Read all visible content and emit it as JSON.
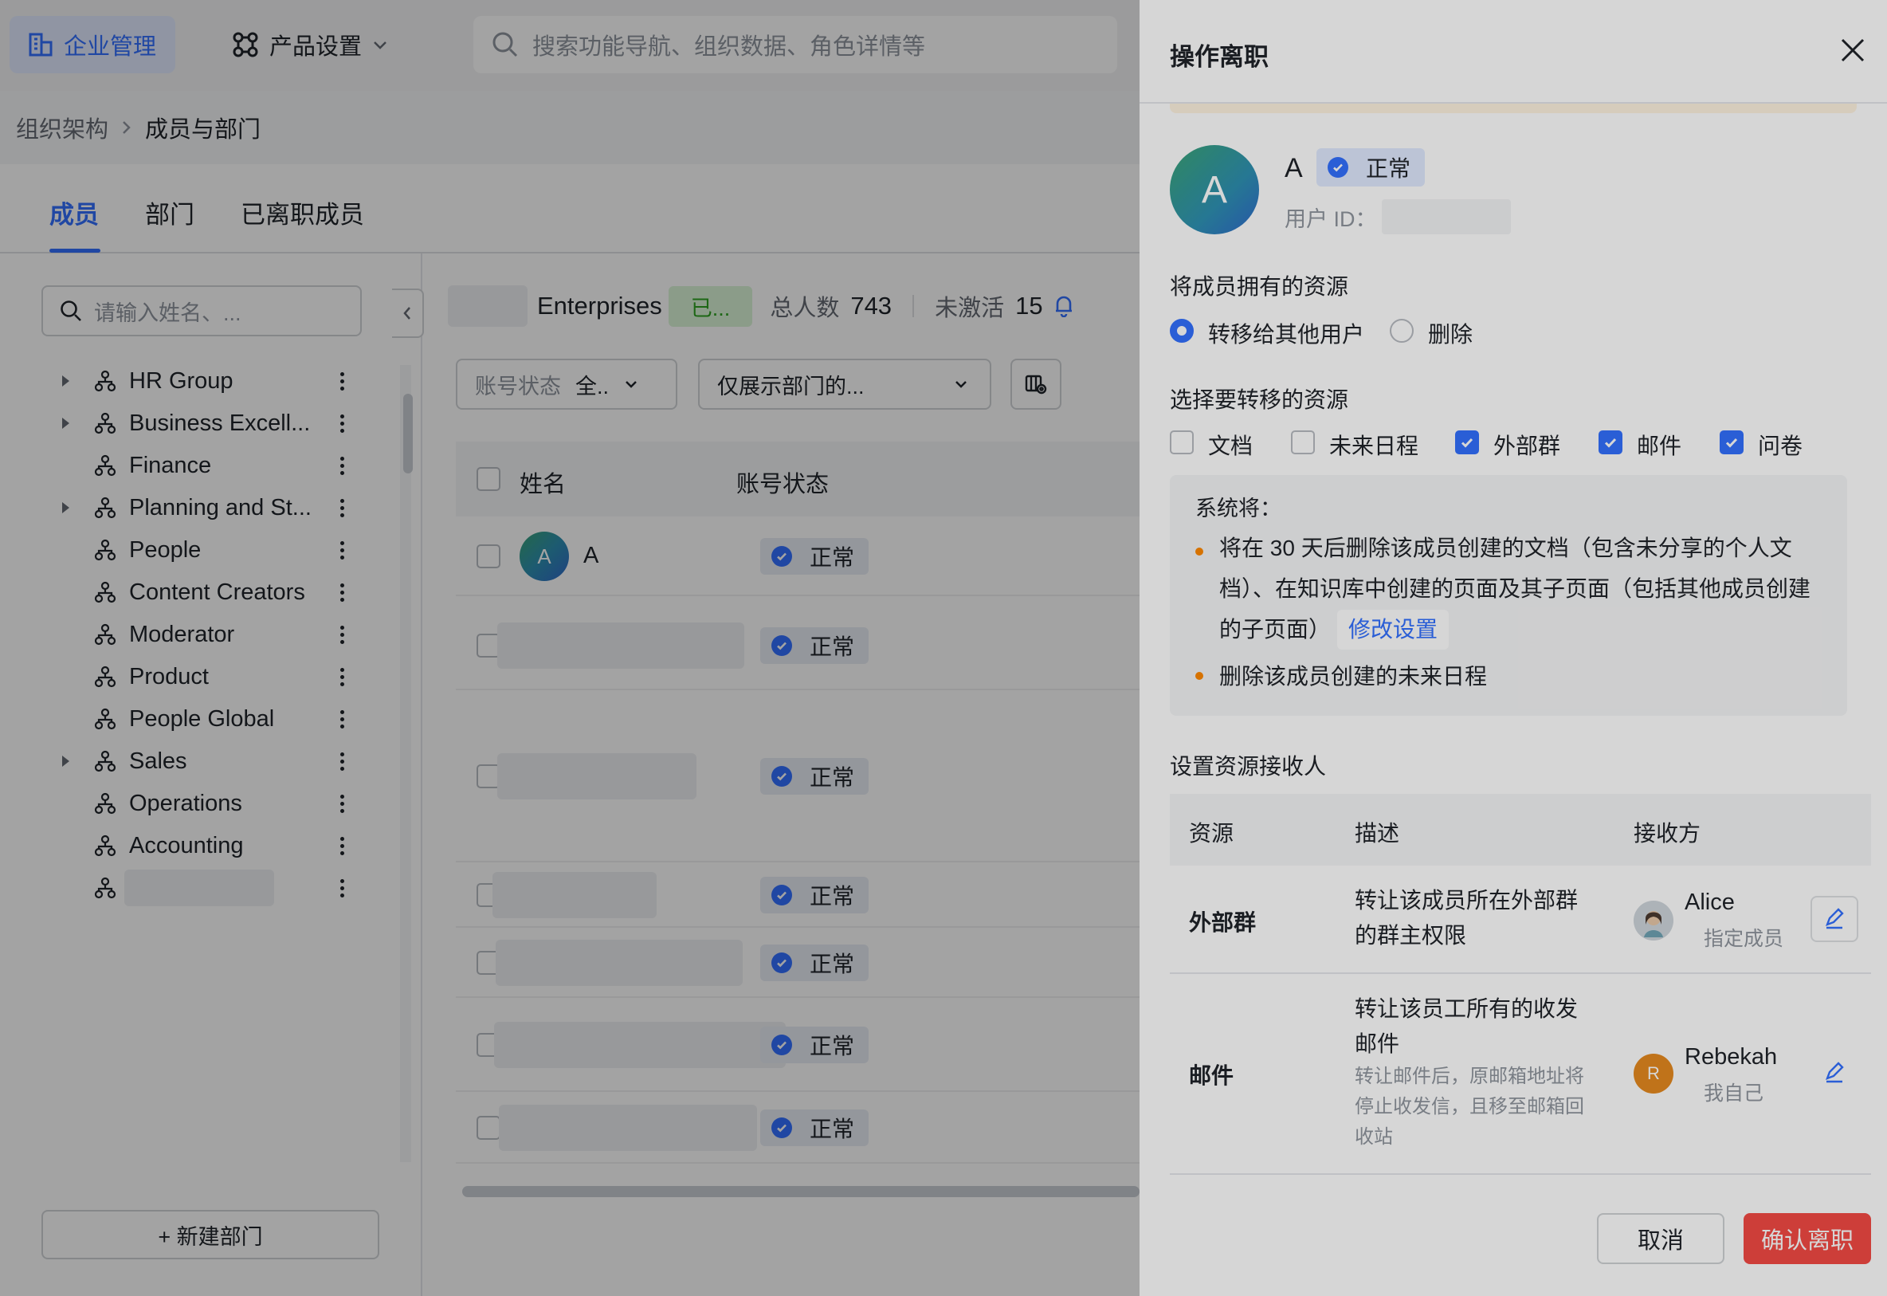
{
  "topbar": {
    "enterprise_label": "企业管理",
    "product_label": "产品设置",
    "search_placeholder": "搜索功能导航、组织数据、角色详情等"
  },
  "breadcrumb": {
    "root": "组织架构",
    "current": "成员与部门"
  },
  "tabs": [
    {
      "label": "成员",
      "active": true
    },
    {
      "label": "部门",
      "active": false
    },
    {
      "label": "已离职成员",
      "active": false
    }
  ],
  "dept_panel": {
    "search_placeholder": "请输入姓名、...",
    "departments": [
      {
        "name": "HR Group",
        "expandable": true
      },
      {
        "name": "Business Excell...",
        "expandable": true
      },
      {
        "name": "Finance",
        "expandable": false
      },
      {
        "name": "Planning and St...",
        "expandable": true
      },
      {
        "name": "People",
        "expandable": false
      },
      {
        "name": "Content Creators",
        "expandable": false
      },
      {
        "name": "Moderator",
        "expandable": false
      },
      {
        "name": "Product",
        "expandable": false
      },
      {
        "name": "People Global",
        "expandable": false
      },
      {
        "name": "Sales",
        "expandable": true
      },
      {
        "name": "Operations",
        "expandable": false
      },
      {
        "name": "Accounting",
        "expandable": false
      },
      {
        "name": "",
        "expandable": false
      }
    ],
    "new_dept_label": "+ 新建部门"
  },
  "members": {
    "org_name": "Enterprises",
    "org_badge": "已...",
    "total_label": "总人数",
    "total_count": "743",
    "inactive_label": "未激活",
    "inactive_count": "15",
    "filter_status_label": "账号状态",
    "filter_status_value": "全..",
    "filter_dept_value": "仅展示部门的...",
    "columns": [
      "姓名",
      "账号状态"
    ],
    "rows": [
      {
        "name": "A",
        "avatar_letter": "A",
        "status": "正常"
      },
      {
        "name": "",
        "status": "正常"
      },
      {
        "name": "",
        "status": "正常"
      },
      {
        "name": "",
        "status": "正常"
      },
      {
        "name": "",
        "status": "正常"
      },
      {
        "name": "",
        "status": "正常"
      },
      {
        "name": "",
        "status": "正常"
      }
    ]
  },
  "drawer": {
    "title": "操作离职",
    "user": {
      "name": "A",
      "avatar_letter": "A",
      "status": "正常",
      "id_label": "用户 ID："
    },
    "owned_resources": {
      "label": "将成员拥有的资源",
      "options": [
        {
          "label": "转移给其他用户",
          "selected": true
        },
        {
          "label": "删除",
          "selected": false
        }
      ]
    },
    "transfer_resources": {
      "label": "选择要转移的资源",
      "items": [
        {
          "label": "文档",
          "checked": false
        },
        {
          "label": "未来日程",
          "checked": false
        },
        {
          "label": "外部群",
          "checked": true
        },
        {
          "label": "邮件",
          "checked": true
        },
        {
          "label": "问卷",
          "checked": true
        }
      ]
    },
    "system_notice": {
      "title": "系统将：",
      "item1_line1": "将在 30 天后删除该成员创建的文档（包含未分享的个人文",
      "item1_line2": "档）、在知识库中创建的页面及其子页面（包括其他成员创建",
      "item1_line3": "的子页面）",
      "modify_link": "修改设置",
      "item2": "删除该成员创建的未来日程"
    },
    "receivers": {
      "label": "设置资源接收人",
      "columns": [
        "资源",
        "描述",
        "接收方"
      ],
      "rows": [
        {
          "resource": "外部群",
          "desc_line1": "转让该成员所在外部群",
          "desc_line2": "的群主权限",
          "receiver": "Alice",
          "receiver_role": "指定成员"
        },
        {
          "resource": "邮件",
          "desc_line1": "转让该员工所有的收发",
          "desc_line2": "邮件",
          "note_line1": "转让邮件后，原邮箱地址将",
          "note_line2": "停止收发信，且移至邮箱回",
          "note_line3": "收站",
          "receiver": "Rebekah",
          "receiver_initial": "R",
          "receiver_role": "我自己"
        }
      ]
    },
    "cancel_label": "取消",
    "confirm_label": "确认离职"
  },
  "colors": {
    "accent": "#3370ff",
    "danger": "#f54a45",
    "warning_dot": "#ff8800",
    "success": "#2ea121"
  }
}
